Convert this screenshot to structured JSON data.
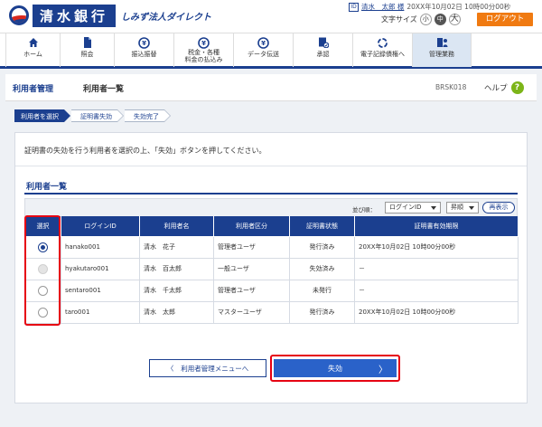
{
  "header": {
    "bank_name": "清水銀行",
    "service_name": "しみず法人ダイレクト",
    "user_icon": "user-card-icon",
    "user_name": "清水　太郎 様",
    "last_login": "20XX年10月02日 10時00分00秒",
    "font_size_label": "文字サイズ",
    "font_small": "小",
    "font_medium": "中",
    "font_large": "大",
    "logout_label": "ログアウト",
    "accent_color": "#1b3f8f",
    "logout_color": "#f07a11"
  },
  "nav": {
    "items": [
      {
        "label": "ホーム",
        "icon": "home-icon"
      },
      {
        "label": "照会",
        "icon": "document-icon"
      },
      {
        "label": "振込振替",
        "icon": "yen-transfer-icon"
      },
      {
        "label": "税金・各種料金の払込み",
        "line1": "税金・各種",
        "line2": "料金の払込み",
        "icon": "yen-tax-icon"
      },
      {
        "label": "データ伝送",
        "icon": "yen-data-icon"
      },
      {
        "label": "承認",
        "icon": "approval-icon"
      },
      {
        "label": "電子記録債権へ",
        "icon": "electronic-claim-icon"
      },
      {
        "label": "管理業務",
        "icon": "admin-icon"
      }
    ]
  },
  "title": {
    "main": "利用者管理",
    "sub": "利用者一覧",
    "screen_id": "BRSK018",
    "help_label": "ヘルプ",
    "help_icon": "?"
  },
  "steps": [
    {
      "label": "利用者を選択",
      "active": true
    },
    {
      "label": "証明書失効",
      "active": false
    },
    {
      "label": "失効完了",
      "active": false
    }
  ],
  "main": {
    "instruction": "証明書の失効を行う利用者を選択の上、「失効」ボタンを押してください。",
    "section_title": "利用者一覧",
    "sort_label": "並び順：",
    "sort_field": "ログインID",
    "sort_order": "昇順",
    "redisplay_label": "再表示",
    "columns": [
      "選択",
      "ログインID",
      "利用者名",
      "利用者区分",
      "証明書状態",
      "証明書有効期限"
    ],
    "rows": [
      {
        "select": "checked",
        "login_id": "hanako001",
        "name": "清水　花子",
        "category": "管理者ユーザ",
        "status": "発行済み",
        "expiry": "20XX年10月02日 10時00分00秒"
      },
      {
        "select": "disabled",
        "login_id": "hyakutaro001",
        "name": "清水　百太郎",
        "category": "一般ユーザ",
        "status": "失効済み",
        "expiry": "－"
      },
      {
        "select": "unchecked",
        "login_id": "sentaro001",
        "name": "清水　千太郎",
        "category": "管理者ユーザ",
        "status": "未発行",
        "expiry": "－"
      },
      {
        "select": "unchecked",
        "login_id": "taro001",
        "name": "清水　太郎",
        "category": "マスターユーザ",
        "status": "発行済み",
        "expiry": "20XX年10月02日 10時00分00秒"
      }
    ],
    "back_button": "利用者管理メニューへ",
    "primary_button": "失効",
    "highlight_color": "#e60012"
  }
}
